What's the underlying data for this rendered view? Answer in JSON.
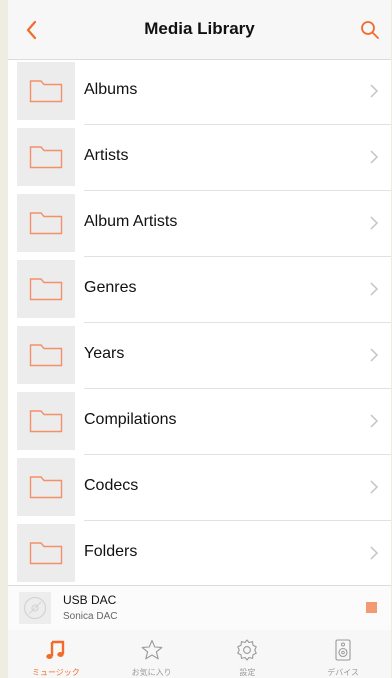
{
  "header": {
    "title": "Media Library",
    "back_icon": "chevron-left-icon",
    "search_icon": "search-icon"
  },
  "library": {
    "items": [
      {
        "label": "Albums",
        "icon": "folder-icon"
      },
      {
        "label": "Artists",
        "icon": "folder-icon"
      },
      {
        "label": "Album Artists",
        "icon": "folder-icon"
      },
      {
        "label": "Genres",
        "icon": "folder-icon"
      },
      {
        "label": "Years",
        "icon": "folder-icon"
      },
      {
        "label": "Compilations",
        "icon": "folder-icon"
      },
      {
        "label": "Codecs",
        "icon": "folder-icon"
      },
      {
        "label": "Folders",
        "icon": "folder-icon"
      }
    ]
  },
  "player": {
    "title": "USB DAC",
    "subtitle": "Sonica DAC",
    "art_icon": "disc-icon",
    "stop_icon": "stop-icon"
  },
  "tabs": [
    {
      "label": "ミュージック",
      "icon": "music-note-icon",
      "active": true
    },
    {
      "label": "お気に入り",
      "icon": "star-icon",
      "active": false
    },
    {
      "label": "設定",
      "icon": "gear-icon",
      "active": false
    },
    {
      "label": "デバイス",
      "icon": "speaker-icon",
      "active": false
    }
  ],
  "colors": {
    "accent": "#f26b2b",
    "folder": "#f2906a",
    "chevron": "#c4c4c4",
    "inactive": "#9a9a9a"
  }
}
